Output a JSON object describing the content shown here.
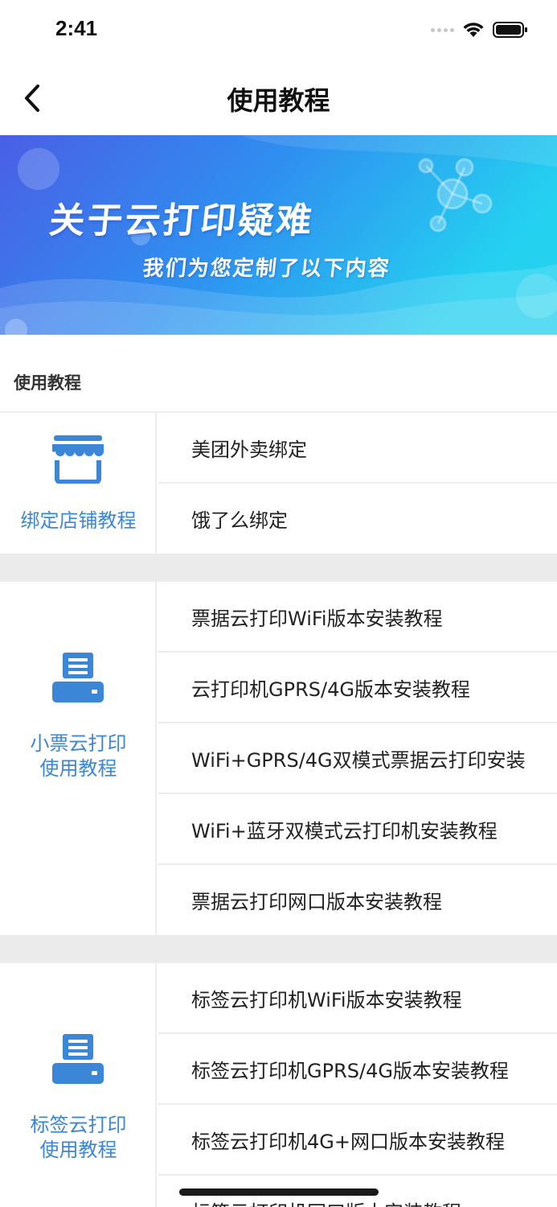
{
  "status_bar": {
    "time": "2:41"
  },
  "nav": {
    "title": "使用教程",
    "back_icon": "chevron-left-icon"
  },
  "banner": {
    "title": "关于云打印疑难",
    "subtitle": "我们为您定制了以下内容",
    "colors": {
      "start": "#4a63e8",
      "mid": "#2f8ff0",
      "end": "#27d3f2"
    }
  },
  "section": {
    "header": "使用教程"
  },
  "categories": [
    {
      "label": "绑定店铺教程",
      "icon": "storefront-icon",
      "items": [
        "美团外卖绑定",
        "饿了么绑定"
      ]
    },
    {
      "label": "小票云打印使用教程",
      "label_lines": [
        "小票云打印",
        "使用教程"
      ],
      "icon": "printer-icon",
      "items": [
        "票据云打印WiFi版本安装教程",
        "云打印机GPRS/4G版本安装教程",
        "WiFi+GPRS/4G双模式票据云打印安装",
        "WiFi+蓝牙双模式云打印机安装教程",
        "票据云打印网口版本安装教程"
      ]
    },
    {
      "label": "标签云打印使用教程",
      "label_lines": [
        "标签云打印",
        "使用教程"
      ],
      "icon": "printer-icon",
      "items": [
        "标签云打印机WiFi版本安装教程",
        "标签云打印机GPRS/4G版本安装教程",
        "标签云打印机4G+网口版本安装教程",
        "标签云打印机网口版本安装教程"
      ]
    }
  ],
  "accent_color": "#3b86d6"
}
